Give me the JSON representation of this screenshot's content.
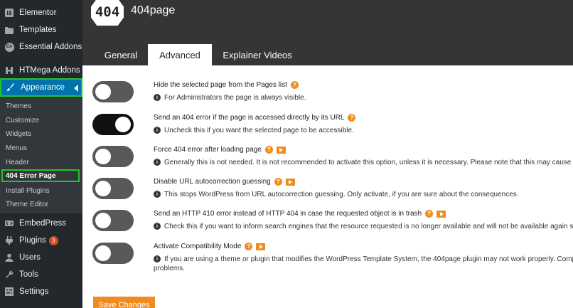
{
  "sidebar": {
    "items": [
      {
        "label": "Elementor",
        "icon": "elementor-icon"
      },
      {
        "label": "Templates",
        "icon": "folder-icon"
      },
      {
        "label": "Essential Addons",
        "icon": "ea-icon",
        "icon_text": "EA"
      },
      {
        "label": "HTMega Addons",
        "icon": "htmega-icon"
      },
      {
        "label": "Appearance",
        "icon": "paintbrush-icon"
      }
    ],
    "submenu": [
      "Themes",
      "Customize",
      "Widgets",
      "Menus",
      "Header",
      "404 Error Page",
      "Install Plugins",
      "Theme Editor"
    ],
    "bottom_items": [
      {
        "label": "EmbedPress",
        "icon": "embedpress-icon"
      },
      {
        "label": "Plugins",
        "icon": "plug-icon",
        "badge": "3"
      },
      {
        "label": "Users",
        "icon": "user-icon"
      },
      {
        "label": "Tools",
        "icon": "wrench-icon"
      },
      {
        "label": "Settings",
        "icon": "settings-icon"
      }
    ]
  },
  "header": {
    "logo_text": "404",
    "title": "404page",
    "tabs": [
      "General",
      "Advanced",
      "Explainer Videos"
    ],
    "active_tab": "Advanced"
  },
  "settings": [
    {
      "title": "Hide the selected page from the Pages list",
      "desc": "For Administrators the page is always visible.",
      "enabled": false,
      "video": false
    },
    {
      "title": "Send an 404 error if the page is accessed directly by its URL",
      "desc": "Uncheck this if you want the selected page to be accessible.",
      "enabled": true,
      "video": false
    },
    {
      "title": "Force 404 error after loading page",
      "desc": "Generally this is not needed. It is not recommended to activate this option, unless it is necessary. Please note that this may cause pr",
      "enabled": false,
      "video": true
    },
    {
      "title": "Disable URL autocorrection guessing",
      "desc": "This stops WordPress from URL autocorrection guessing. Only activate, if you are sure about the consequences.",
      "enabled": false,
      "video": true
    },
    {
      "title": "Send an HTTP 410 error instead of HTTP 404 in case the requested object is in trash",
      "desc": "Check this if you want to inform search engines that the resource requested is no longer available and will not be available again so",
      "enabled": false,
      "video": true
    },
    {
      "title": "Activate Compatibility Mode",
      "desc": "If you are using a theme or plugin that modifies the WordPress Template System, the 404page plugin may not work properly. Comp",
      "desc2": "problems.",
      "enabled": false,
      "video": true
    }
  ],
  "save_label": "Save Changes",
  "colors": {
    "sidebar_bg": "#23282d",
    "active_blue": "#0073aa",
    "highlight_green": "#22c42b",
    "accent_orange": "#f08c1f",
    "header_bg": "#353535"
  }
}
